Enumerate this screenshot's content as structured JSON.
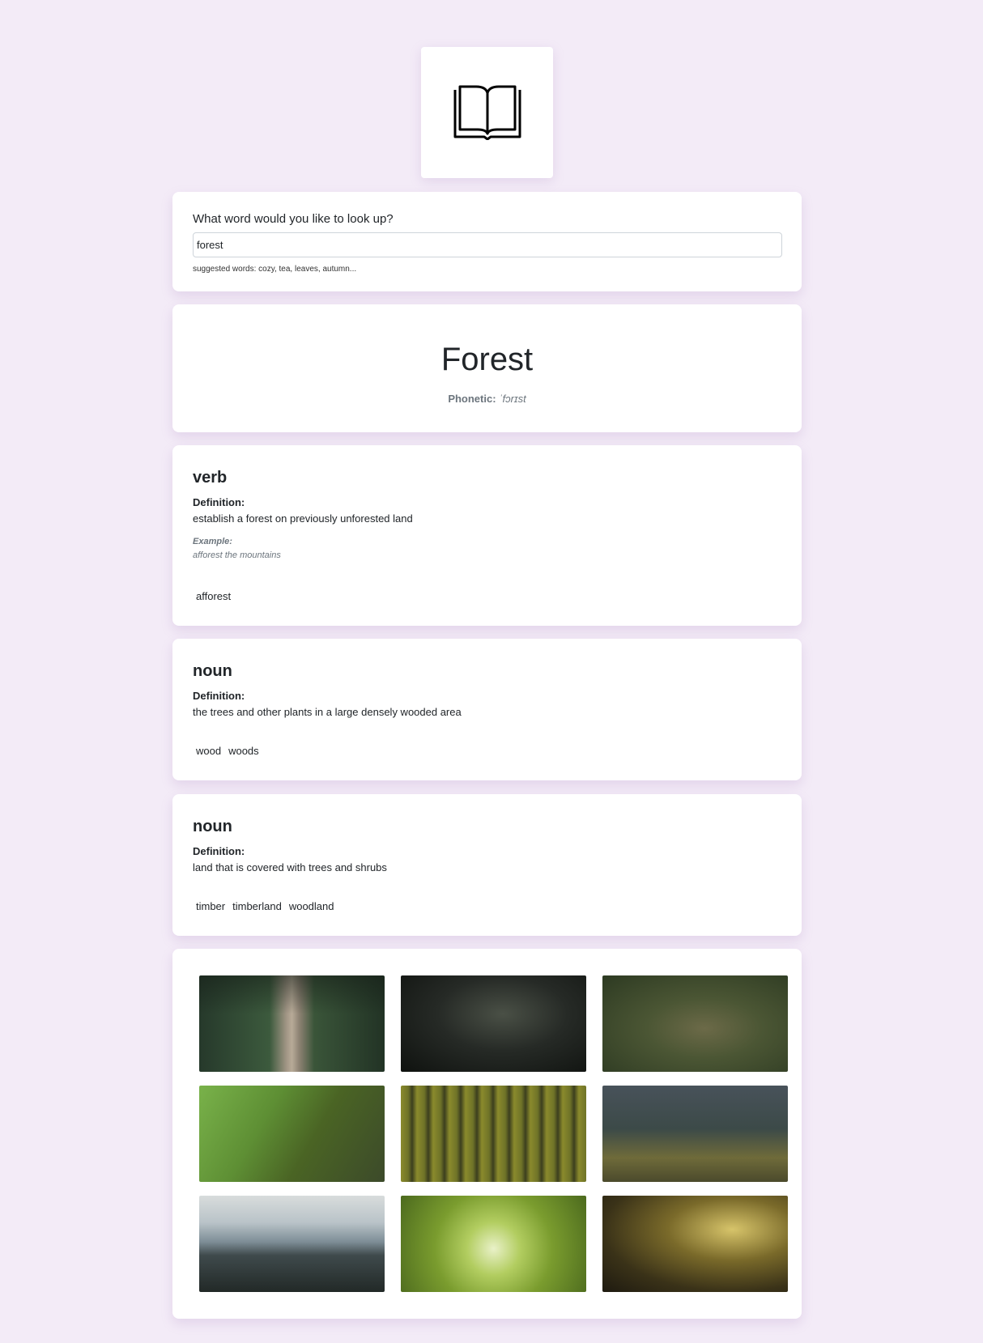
{
  "logo": {
    "icon": "open-book-icon"
  },
  "search": {
    "question": "What word would you like to look up?",
    "value": "forest",
    "hint": "suggested words: cozy, tea, leaves, autumn..."
  },
  "word": {
    "title": "Forest",
    "phonetic_label": "Phonetic:",
    "phonetic_value": "ˈfɔrɪst"
  },
  "meanings": [
    {
      "part_of_speech": "verb",
      "definition_label": "Definition:",
      "definition": "establish a forest on previously unforested land",
      "example_label": "Example:",
      "example": "afforest the mountains",
      "synonyms": [
        "afforest"
      ]
    },
    {
      "part_of_speech": "noun",
      "definition_label": "Definition:",
      "definition": "the trees and other plants in a large densely wooded area",
      "synonyms": [
        "wood",
        "woods"
      ]
    },
    {
      "part_of_speech": "noun",
      "definition_label": "Definition:",
      "definition": "land that is covered with trees and shrubs",
      "synonyms": [
        "timber",
        "timberland",
        "woodland"
      ]
    }
  ],
  "photos": [
    {
      "name": "forest-bridge-photo"
    },
    {
      "name": "dark-forest-photo"
    },
    {
      "name": "old-oak-tree-photo"
    },
    {
      "name": "mossy-tree-roots-photo"
    },
    {
      "name": "pine-treetops-aerial-photo"
    },
    {
      "name": "sunlit-forest-trunks-photo"
    },
    {
      "name": "misty-mountain-forest-photo"
    },
    {
      "name": "canopy-from-below-photo"
    },
    {
      "name": "golden-forest-light-photo"
    }
  ]
}
